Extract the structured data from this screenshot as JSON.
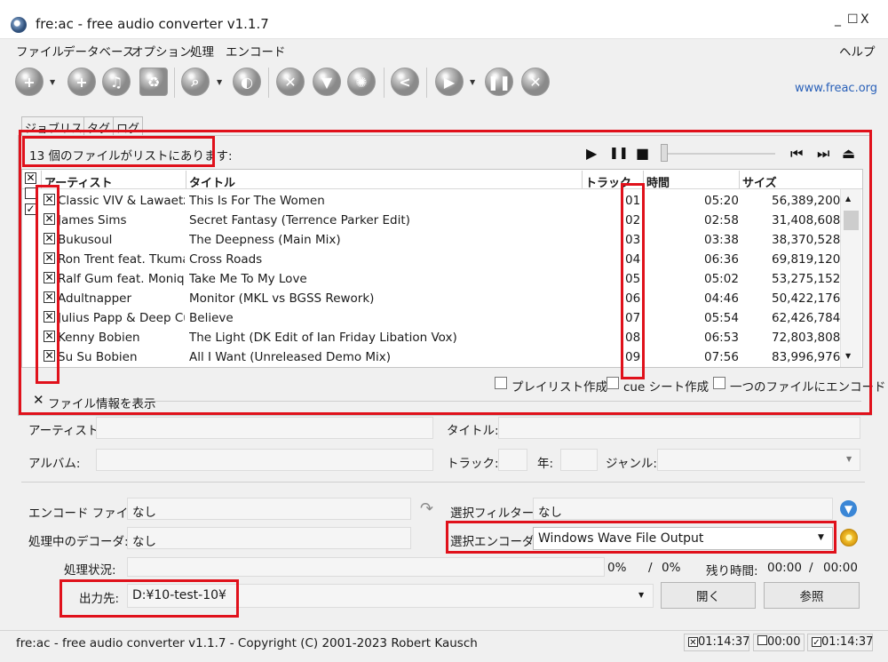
{
  "window": {
    "title": "fre:ac - free audio converter v1.1.7",
    "minimize": "_",
    "maximize": "☐",
    "close": "X"
  },
  "menu": [
    "ファイル",
    "データベース",
    "オプション",
    "処理",
    "エンコード",
    "ヘルプ"
  ],
  "toolbar": {
    "icons": [
      "add-files-icon",
      "add-cd-icon",
      "add-music-icon",
      "remove-icon",
      "search-icon",
      "cd-info-icon",
      "settings-tools-icon",
      "filter-icon",
      "gear-icon",
      "share-icon",
      "play-icon",
      "pause-icon",
      "stop-icon"
    ],
    "site": "www.freac.org"
  },
  "tabs": [
    "ジョブリスト",
    "タグ",
    "ログ"
  ],
  "joblist": {
    "count_text": "13 個のファイルがリストにあります:",
    "player": {
      "play": "▶",
      "pause": "❚❚",
      "stop": "■",
      "prev": "⏮",
      "next": "⏭",
      "eject": "⏏"
    },
    "headers": {
      "artist": "アーティスト",
      "title": "タイトル",
      "track": "トラック",
      "time": "時間",
      "size": "サイズ"
    },
    "rows": [
      {
        "artist": "Classic VIV & Lawaetz",
        "title": "This Is For The Women",
        "track": "01",
        "time": "05:20",
        "size": "56,389,200"
      },
      {
        "artist": "James Sims",
        "title": "Secret Fantasy (Terrence Parker Edit)",
        "track": "02",
        "time": "02:58",
        "size": "31,408,608"
      },
      {
        "artist": "Bukusoul",
        "title": "The Deepness (Main Mix)",
        "track": "03",
        "time": "03:38",
        "size": "38,370,528"
      },
      {
        "artist": "Ron Trent feat. Tkumah",
        "title": "Cross Roads",
        "track": "04",
        "time": "06:36",
        "size": "69,819,120"
      },
      {
        "artist": "Ralf Gum feat. Monique",
        "title": "Take Me To My Love",
        "track": "05",
        "time": "05:02",
        "size": "53,275,152"
      },
      {
        "artist": "Adultnapper",
        "title": "Monitor (MKL vs BGSS Rework)",
        "track": "06",
        "time": "04:46",
        "size": "50,422,176"
      },
      {
        "artist": "Julius Papp & Deep Cu",
        "title": "Believe",
        "track": "07",
        "time": "05:54",
        "size": "62,426,784"
      },
      {
        "artist": "Kenny Bobien",
        "title": "The Light (DK Edit of Ian Friday Libation Vox)",
        "track": "08",
        "time": "06:53",
        "size": "72,803,808"
      },
      {
        "artist": "Su Su Bobien",
        "title": "All I Want (Unreleased Demo Mix)",
        "track": "09",
        "time": "07:56",
        "size": "83,996,976"
      }
    ],
    "options": [
      "プレイリスト作成",
      "cue シート作成",
      "一つのファイルにエンコード"
    ],
    "show_info": "ファイル情報を表示"
  },
  "info": {
    "artist_label": "アーティスト:",
    "title_label": "タイトル:",
    "album_label": "アルバム:",
    "track_label": "トラック:",
    "year_label": "年:",
    "genre_label": "ジャンル:"
  },
  "encode": {
    "file_label": "エンコード ファイル:",
    "file_value": "なし",
    "filter_label": "選択フィルター:",
    "filter_value": "なし",
    "decoder_label": "処理中のデコーダ:",
    "decoder_value": "なし",
    "encoder_label": "選択エンコーダ:",
    "encoder_value": "Windows Wave File Output",
    "status_label": "処理状況:",
    "pct1": "0%",
    "slash": "/",
    "pct2": "0%",
    "remain_label": "残り時間:",
    "remain1": "00:00",
    "remain2": "00:00",
    "output_label": "出力先:",
    "output_value": "D:¥10-test-10¥",
    "open_button": "開く",
    "browse_button": "参照"
  },
  "status": {
    "text": "fre:ac - free audio converter v1.1.7 - Copyright (C) 2001-2023 Robert Kausch",
    "total_checked": "01:14:37",
    "total_unchecked": "00:00",
    "total_all": "01:14:37"
  },
  "colors": {
    "highlight_red": "#e0111b",
    "link_blue": "#2960b8"
  }
}
